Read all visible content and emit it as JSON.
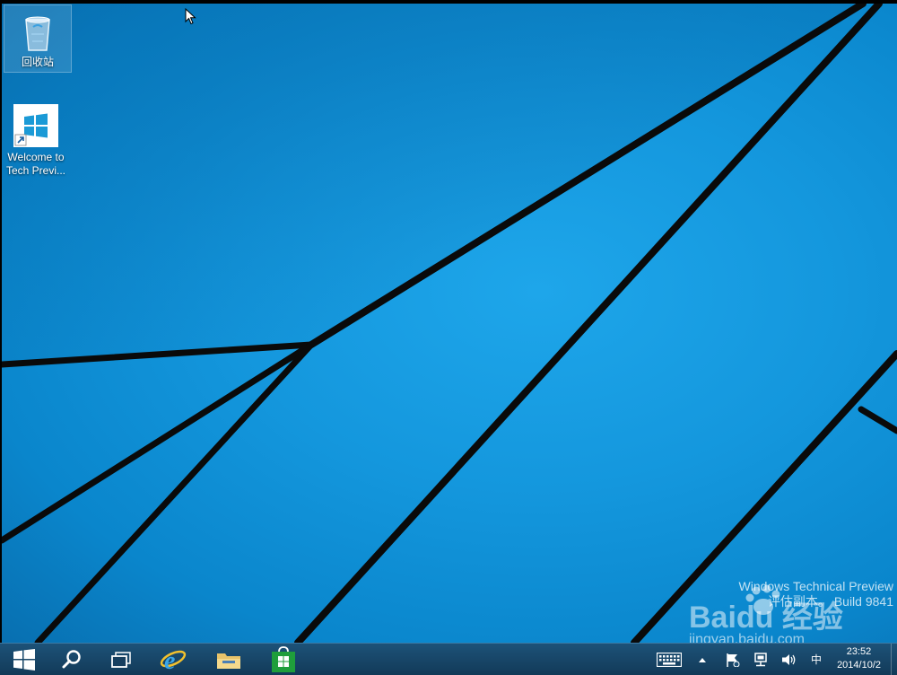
{
  "desktop": {
    "icons": [
      {
        "label": "回收站",
        "icon": "recycle-bin-icon"
      },
      {
        "label_lines": [
          "Welcome to",
          "Tech Previ..."
        ],
        "icon": "windows-tile-icon"
      }
    ],
    "watermark": {
      "line1": "Windows Technical Preview",
      "line2": "评估副本。 Build 9841"
    },
    "overlay": {
      "brand": "Baidu 经验",
      "url": "jingyan.baidu.com"
    }
  },
  "taskbar": {
    "buttons": [
      {
        "name": "start-button",
        "icon": "windows-logo-icon"
      },
      {
        "name": "search-button",
        "icon": "search-icon"
      },
      {
        "name": "task-view-button",
        "icon": "task-view-icon"
      },
      {
        "name": "internet-explorer-button",
        "icon": "ie-icon"
      },
      {
        "name": "file-explorer-button",
        "icon": "folder-icon"
      },
      {
        "name": "store-button",
        "icon": "store-icon"
      }
    ],
    "tray": {
      "ime_label": "中",
      "time": "23:52",
      "date": "2014/10/2"
    }
  },
  "colors": {
    "desktop_blue": "#1497dd",
    "taskbar": "#173f5f",
    "store_green": "#1f9e3b",
    "folder": "#e8c36a"
  }
}
